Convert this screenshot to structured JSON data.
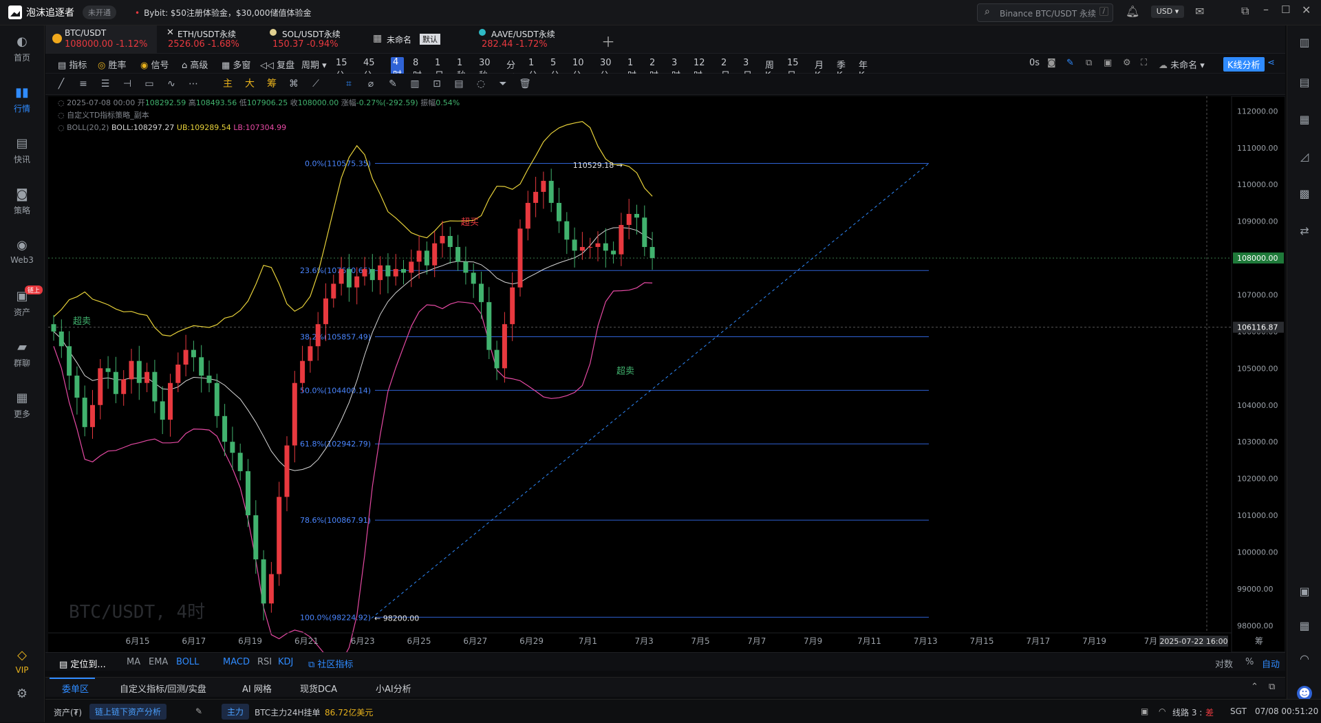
{
  "app": {
    "name": "泡沫追逐者",
    "status_badge": "未开通"
  },
  "ad": {
    "text": "Bybit: $50注册体验金，$30,000储值体验金"
  },
  "search": {
    "placeholder": "Binance BTC/USDT 永续",
    "shortcut": "/"
  },
  "currency": "USD",
  "sidebar": [
    {
      "label": "首页",
      "icon": "home-icon"
    },
    {
      "label": "行情",
      "icon": "chart-bars-icon",
      "active": true
    },
    {
      "label": "快讯",
      "icon": "news-icon"
    },
    {
      "label": "策略",
      "icon": "robot-icon"
    },
    {
      "label": "Web3",
      "icon": "web3-icon"
    },
    {
      "label": "资产",
      "icon": "wallet-icon",
      "badge": "链上"
    },
    {
      "label": "群聊",
      "icon": "chat-icon"
    },
    {
      "label": "更多",
      "icon": "grid-icon"
    },
    {
      "label": "VIP",
      "icon": "vip-icon"
    }
  ],
  "tabs": [
    {
      "name": "BTC/USDT",
      "price": "108000.00",
      "change": "-1.12%",
      "coin_color": "#f0a81c"
    },
    {
      "name": "ETH/USDT永续",
      "price": "2526.06",
      "change": "-1.68%",
      "coin_color": ""
    },
    {
      "name": "SOL/USDT永续",
      "price": "150.37",
      "change": "-0.94%",
      "coin_color": "#e0d090"
    },
    {
      "name": "未命名",
      "price": "",
      "change": "",
      "tag": "默认"
    },
    {
      "name": "AAVE/USDT永续",
      "price": "282.44",
      "change": "-1.72%",
      "coin_color": "#2ebac6"
    }
  ],
  "toolbar1": {
    "left_items": [
      "指标",
      "胜率",
      "信号",
      "高级",
      "多窗",
      "复盘",
      "周期"
    ],
    "intervals": [
      "15分",
      "45分",
      "4时",
      "8时",
      "1日",
      "1秒",
      "30秒",
      "分时",
      "1分",
      "5分",
      "10分",
      "30分",
      "1时",
      "2时",
      "3时",
      "12时",
      "2日",
      "3日",
      "周K",
      "15日",
      "月K",
      "季K",
      "年K"
    ],
    "active_interval": "4时",
    "right": {
      "latency": "0s",
      "layout_name": "未命名",
      "kline_button": "K线分析"
    }
  },
  "toolbar2": {
    "chars": [
      "主",
      "大",
      "筹"
    ]
  },
  "legend": {
    "date": "2025-07-08 00:00",
    "open_label": "开",
    "open": "108292.59",
    "high_label": "高",
    "high": "108493.56",
    "low_label": "低",
    "low": "107906.25",
    "close_label": "收",
    "close": "108000.00",
    "change_label": "涨幅",
    "change": "-0.27%(-292.59)",
    "amp_label": "振幅",
    "amp": "0.54%",
    "strategy": "自定义TD指标策略_副本",
    "boll": "BOLL(20,2)",
    "boll_mid": "BOLL:108297.27",
    "boll_ub": "UB:109289.54",
    "boll_lb": "LB:107304.99"
  },
  "chart_data": {
    "type": "candlestick",
    "symbol_watermark": "BTC/USDT, 4时",
    "y_range": [
      97800,
      112400
    ],
    "y_ticks": [
      "112000.00",
      "111000.00",
      "110000.00",
      "109000.00",
      "108000.00",
      "107000.00",
      "106000.00",
      "105000.00",
      "104000.00",
      "103000.00",
      "102000.00",
      "101000.00",
      "100000.00",
      "99000.00",
      "98000.00"
    ],
    "x_ticks": [
      "6月15",
      "6月17",
      "6月19",
      "6月21",
      "6月23",
      "6月25",
      "6月27",
      "6月29",
      "7月1",
      "7月3",
      "7月5",
      "7月7",
      "7月9",
      "7月11",
      "7月13",
      "7月15",
      "7月17",
      "7月19",
      "7月"
    ],
    "current_price": "108000.00",
    "crosshair_price": "106116.87",
    "crosshair_time": "2025-07-22 16:00",
    "fib_levels": [
      {
        "label": "0.0%(110575.35)",
        "value": 110575.35
      },
      {
        "label": "23.6%(107660.65)",
        "value": 107660.65
      },
      {
        "label": "38.2%(105857.49)",
        "value": 105857.49
      },
      {
        "label": "50.0%(104400.14)",
        "value": 104400.14
      },
      {
        "label": "61.8%(102942.79)",
        "value": 102942.79
      },
      {
        "label": "78.6%(100867.91)",
        "value": 100867.91
      },
      {
        "label": "100.0%(98224.92)",
        "value": 98224.92
      }
    ],
    "high_marker": "110529.18",
    "low_marker": "98200.00",
    "annotations": [
      "超买",
      "超卖",
      "超卖"
    ],
    "last_close_series": [
      106000,
      105600,
      104800,
      104200,
      103400,
      104000,
      105000,
      104900,
      104300,
      104700,
      105200,
      104600,
      104900,
      104100,
      103600,
      104600,
      105100,
      105500,
      105300,
      104800,
      104600,
      103700,
      103000,
      102700,
      102200,
      101000,
      99800,
      98600,
      99400,
      101500,
      102900,
      104600,
      105200,
      105600,
      106200,
      106900,
      107300,
      107700,
      107200,
      107500,
      107700,
      107400,
      107800,
      107500,
      107700,
      107600,
      107900,
      108200,
      107800,
      108400,
      108600,
      108300,
      107900,
      107600,
      107300,
      106800,
      105500,
      105000,
      106200,
      107200,
      108800,
      109500,
      109800,
      110100,
      109500,
      109000,
      108500,
      108200,
      108300,
      108300,
      108400,
      108200,
      108100,
      108900,
      109200,
      109100,
      108300,
      108000
    ]
  },
  "indicator_bar": {
    "locate": "定位到...",
    "main": [
      "MA",
      "EMA",
      "BOLL"
    ],
    "sub": [
      "MACD",
      "RSI",
      "KDJ"
    ],
    "community": "社区指标",
    "right": [
      "对数",
      "%",
      "自动"
    ]
  },
  "bottom_tabs": [
    "委单区",
    "自定义指标/回测/实盘",
    "AI 网格",
    "现货DCA",
    "小AI分析"
  ],
  "status": {
    "assets": "资产(₮)",
    "asset_analysis": "链上链下资产分析",
    "main_force_tag": "主力",
    "main_force_text": "BTC主力24H挂单",
    "main_force_value": "86.72亿美元",
    "route": "线路 3 :",
    "route_quality": "差",
    "timezone": "SGT",
    "time": "07/08 00:51:20"
  }
}
